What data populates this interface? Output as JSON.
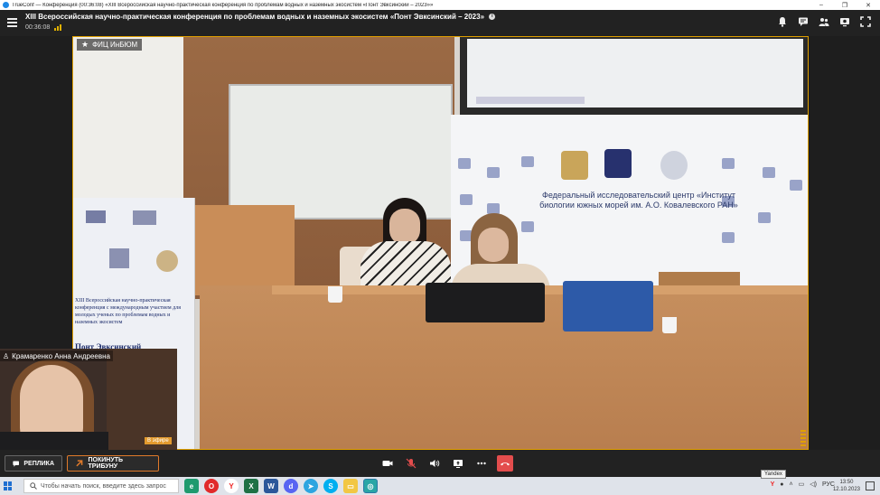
{
  "window": {
    "title": "TrueConf — Конференция (00:36:08) «XIII Всероссийская научно-практическая конференция по проблемам водных и наземных экосистем «Понт Эвксинский – 2023»»",
    "minimize": "–",
    "maximize": "❐",
    "close": "✕"
  },
  "header": {
    "conference_title": "XIII Всероссийская научно-практическая конференция по проблемам водных и наземных экосистем «Понт Эвксинский – 2023»",
    "elapsed": "00:36:08",
    "info_icon": "i"
  },
  "video": {
    "speaker_label": "ФИЦ ИнБЮМ",
    "banner_text": "Федеральный исследовательский центр «Институт биологии южных морей им. А.О. Ковалевского РАН»",
    "podium_text": "XIII Всероссийская научно-практическая конференция с международным участием для молодых ученых по проблемам водных и наземных экосистем",
    "podium_big": "Понт Эвксинский"
  },
  "self_view": {
    "name": "Крамаренко Анна Андреевна",
    "badge": "В эфире"
  },
  "toolbar": {
    "reply_label": "РЕПЛИКА",
    "leave_label": "ПОКИНУТЬ ТРИБУНУ"
  },
  "taskbar": {
    "search_placeholder": "Чтобы начать поиск, введите здесь запрос",
    "tooltip": "Yandex",
    "language": "РУС",
    "time": "13:50",
    "date": "12.10.2023"
  },
  "colors": {
    "accent_orange": "#e0a000",
    "hangup_red": "#e34d4d",
    "header_bg": "#222222"
  }
}
